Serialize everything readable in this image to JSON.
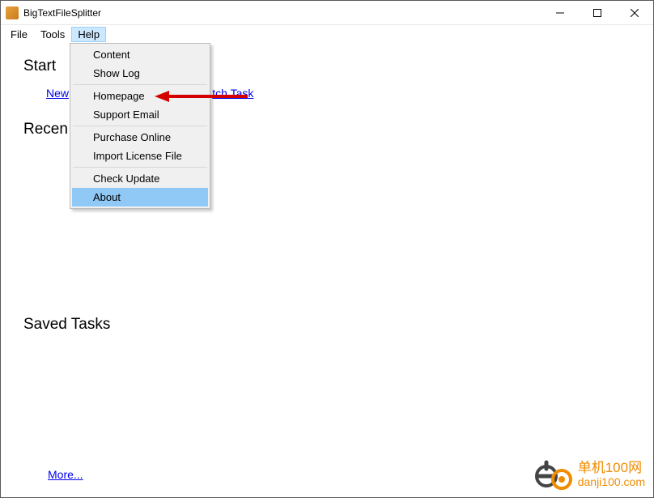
{
  "window": {
    "title": "BigTextFileSplitter"
  },
  "menubar": {
    "file": "File",
    "tools": "Tools",
    "help": "Help"
  },
  "dropdown": {
    "content": "Content",
    "showlog": "Show Log",
    "homepage": "Homepage",
    "supportemail": "Support Email",
    "purchase": "Purchase Online",
    "importlicense": "Import License File",
    "checkupdate": "Check Update",
    "about": "About"
  },
  "sections": {
    "start": "Start",
    "recent": "Recen",
    "saved": "Saved Tasks"
  },
  "links": {
    "newtask_fragment": "New",
    "batchtask_fragment": "tch Task",
    "more": "More..."
  },
  "watermark": {
    "line1": "单机100网",
    "line2": "danji100.com"
  }
}
